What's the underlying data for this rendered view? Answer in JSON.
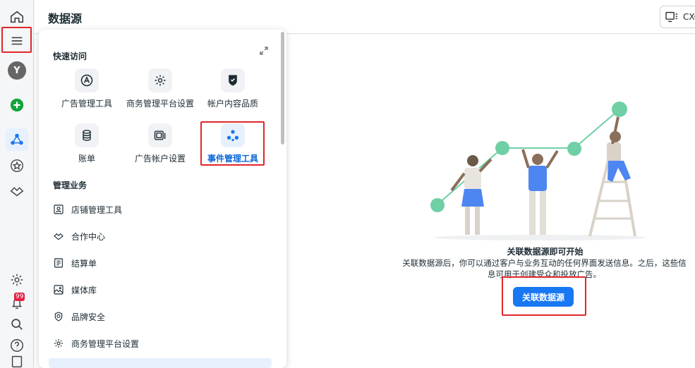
{
  "header": {
    "title": "数据源",
    "account_label": "CXC"
  },
  "notifications": {
    "badge": "99"
  },
  "avatar": {
    "initial": "Y"
  },
  "panel": {
    "quick_access_title": "快速访问",
    "tiles": [
      {
        "label": "广告管理工具",
        "icon": "ads-manager-icon"
      },
      {
        "label": "商务管理平台设置",
        "icon": "gear-icon"
      },
      {
        "label": "帐户内容品质",
        "icon": "shield-icon"
      },
      {
        "label": "账单",
        "icon": "billing-icon"
      },
      {
        "label": "广告帐户设置",
        "icon": "ad-account-settings-icon"
      },
      {
        "label": "事件管理工具",
        "icon": "events-manager-icon"
      }
    ],
    "manage_title": "管理业务",
    "items": [
      {
        "label": "店铺管理工具",
        "icon": "shop-icon"
      },
      {
        "label": "合作中心",
        "icon": "handshake-icon"
      },
      {
        "label": "结算单",
        "icon": "statement-icon"
      },
      {
        "label": "媒体库",
        "icon": "media-icon"
      },
      {
        "label": "品牌安全",
        "icon": "brand-safety-icon"
      },
      {
        "label": "商务管理平台设置",
        "icon": "gear-icon"
      }
    ]
  },
  "cta": {
    "title": "关联数据源即可开始",
    "desc_line1": "关联数据源后，你可以通过客户与业务互动的任何界面发送信息。之后，这些信",
    "desc_line2": "息可用于创建受众和投放广告。",
    "button": "关联数据源"
  },
  "colors": {
    "primary": "#1877f2",
    "highlight": "#e0262b",
    "teal": "#6fcfa5"
  }
}
